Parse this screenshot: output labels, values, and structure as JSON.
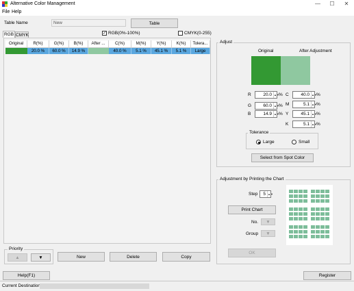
{
  "window": {
    "title": "Alternative Color Management",
    "minimize": "—",
    "maximize": "☐",
    "close": "✕"
  },
  "menu": {
    "file": "File",
    "help": "Help"
  },
  "table_name": {
    "label": "Table Name",
    "value": "New",
    "table_button": "Table"
  },
  "tabs": {
    "rgb": "RGB",
    "cmyk": "CMYK"
  },
  "mode_checks": {
    "rgb_label": "RGB(0%-100%)",
    "rgb_checked": true,
    "cmyk_label": "CMYK(0-255)",
    "cmyk_checked": false
  },
  "grid": {
    "headers": [
      "Original",
      "R(%)",
      "G(%)",
      "B(%)",
      "After ...",
      "C(%)",
      "M(%)",
      "Y(%)",
      "K(%)",
      "Tolera..."
    ],
    "rows": [
      {
        "original_color": "#339933",
        "r": "20.0 %",
        "g": "60.0 %",
        "b": "14.9 %",
        "after_color": "#8fc8a0",
        "c": "40.0 %",
        "m": "5.1 %",
        "y": "45.1 %",
        "k": "5.1 %",
        "tolerance": "Large"
      }
    ]
  },
  "priority": {
    "label": "Priority",
    "up": "▲",
    "down": "▼"
  },
  "actions": {
    "new": "New",
    "delete": "Delete",
    "copy": "Copy"
  },
  "adjust": {
    "title": "Adjust",
    "original_label": "Original",
    "after_label": "After Adjustment",
    "original_color": "#339933",
    "after_color": "#8fc8a0",
    "rgb_fields": [
      {
        "label": "R",
        "value": "20.0",
        "unit": "%"
      },
      {
        "label": "G",
        "value": "60.0",
        "unit": "%"
      },
      {
        "label": "B",
        "value": "14.9",
        "unit": "%"
      }
    ],
    "cmyk_fields": [
      {
        "label": "C",
        "value": "40.0",
        "unit": "%"
      },
      {
        "label": "M",
        "value": "5.1",
        "unit": "%"
      },
      {
        "label": "Y",
        "value": "45.1",
        "unit": "%"
      },
      {
        "label": "K",
        "value": "5.1",
        "unit": "%"
      }
    ],
    "tolerance": {
      "title": "Tolerance",
      "large": "Large",
      "small": "Small",
      "selected": "Large"
    },
    "spot_button": "Select from Spot Color"
  },
  "chart_adjust": {
    "title": "Adjustment by Printing the Chart",
    "step_label": "Step",
    "step_value": "5",
    "print_button": "Print Chart",
    "no_label": "No.",
    "group_label": "Group",
    "ok_button": "OK",
    "chip_color": "#7dbd9a"
  },
  "bottom": {
    "help": "Help(F1)",
    "register": "Register"
  },
  "status": {
    "label": "Current Destination"
  }
}
